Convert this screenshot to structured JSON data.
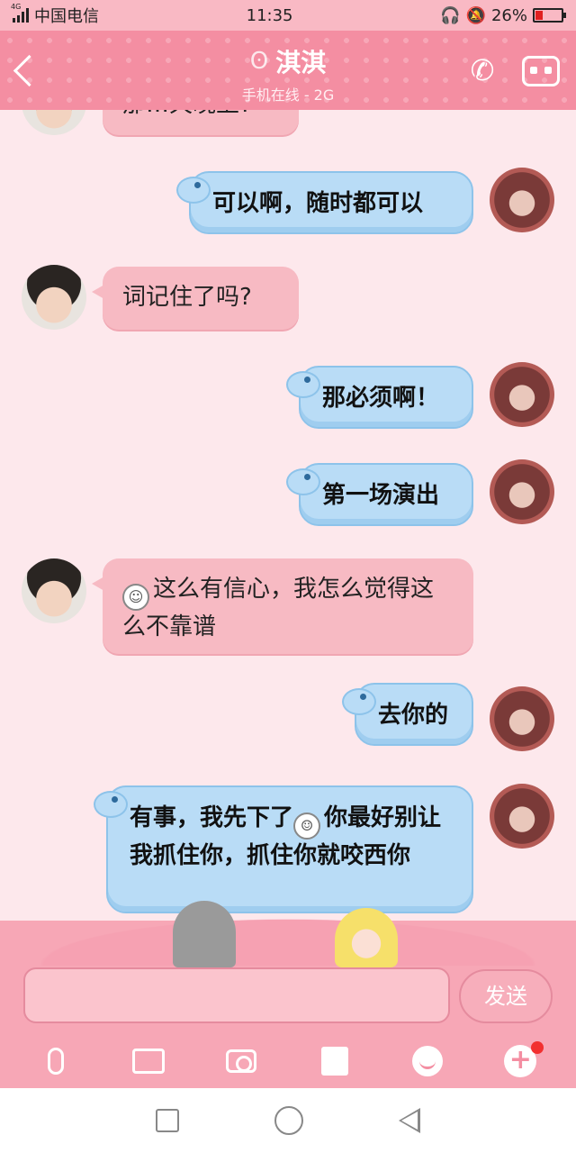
{
  "status_bar": {
    "network_tag": "4G",
    "carrier": "中国电信",
    "time": "11:35",
    "battery": "26%",
    "battery_level": 0.26
  },
  "header": {
    "title": "淇淇",
    "subtitle": "手机在线 - 2G",
    "icons": [
      "back-icon",
      "ear-icon",
      "phone-icon",
      "profile-icon"
    ]
  },
  "messages": [
    {
      "side": "in",
      "text": "那…天晚上?",
      "partial": true
    },
    {
      "side": "out",
      "text": "可以啊，随时都可以"
    },
    {
      "side": "in",
      "text": "词记住了吗?"
    },
    {
      "side": "out",
      "text": "那必须啊！"
    },
    {
      "side": "out",
      "text": "第一场演出"
    },
    {
      "side": "in",
      "text": "这么有信心，我怎么觉得这么不靠谱",
      "emoji": "☺"
    },
    {
      "side": "out",
      "text": "去你的"
    },
    {
      "side": "out",
      "text_before": "有事，我先下了",
      "emoji": "☺",
      "text_after": "你最好别让我抓住你，抓住你就咬西你"
    }
  ],
  "input": {
    "placeholder": "",
    "send_label": "发送"
  },
  "toolbar": {
    "icons": [
      "microphone-icon",
      "image-icon",
      "camera-icon",
      "red-packet-icon",
      "emoji-icon",
      "plus-icon"
    ]
  },
  "colors": {
    "header": "#f48ea2",
    "incoming_bubble": "#f7bac3",
    "outgoing_bubble": "#b9dcf6",
    "background": "#fde8ec"
  }
}
